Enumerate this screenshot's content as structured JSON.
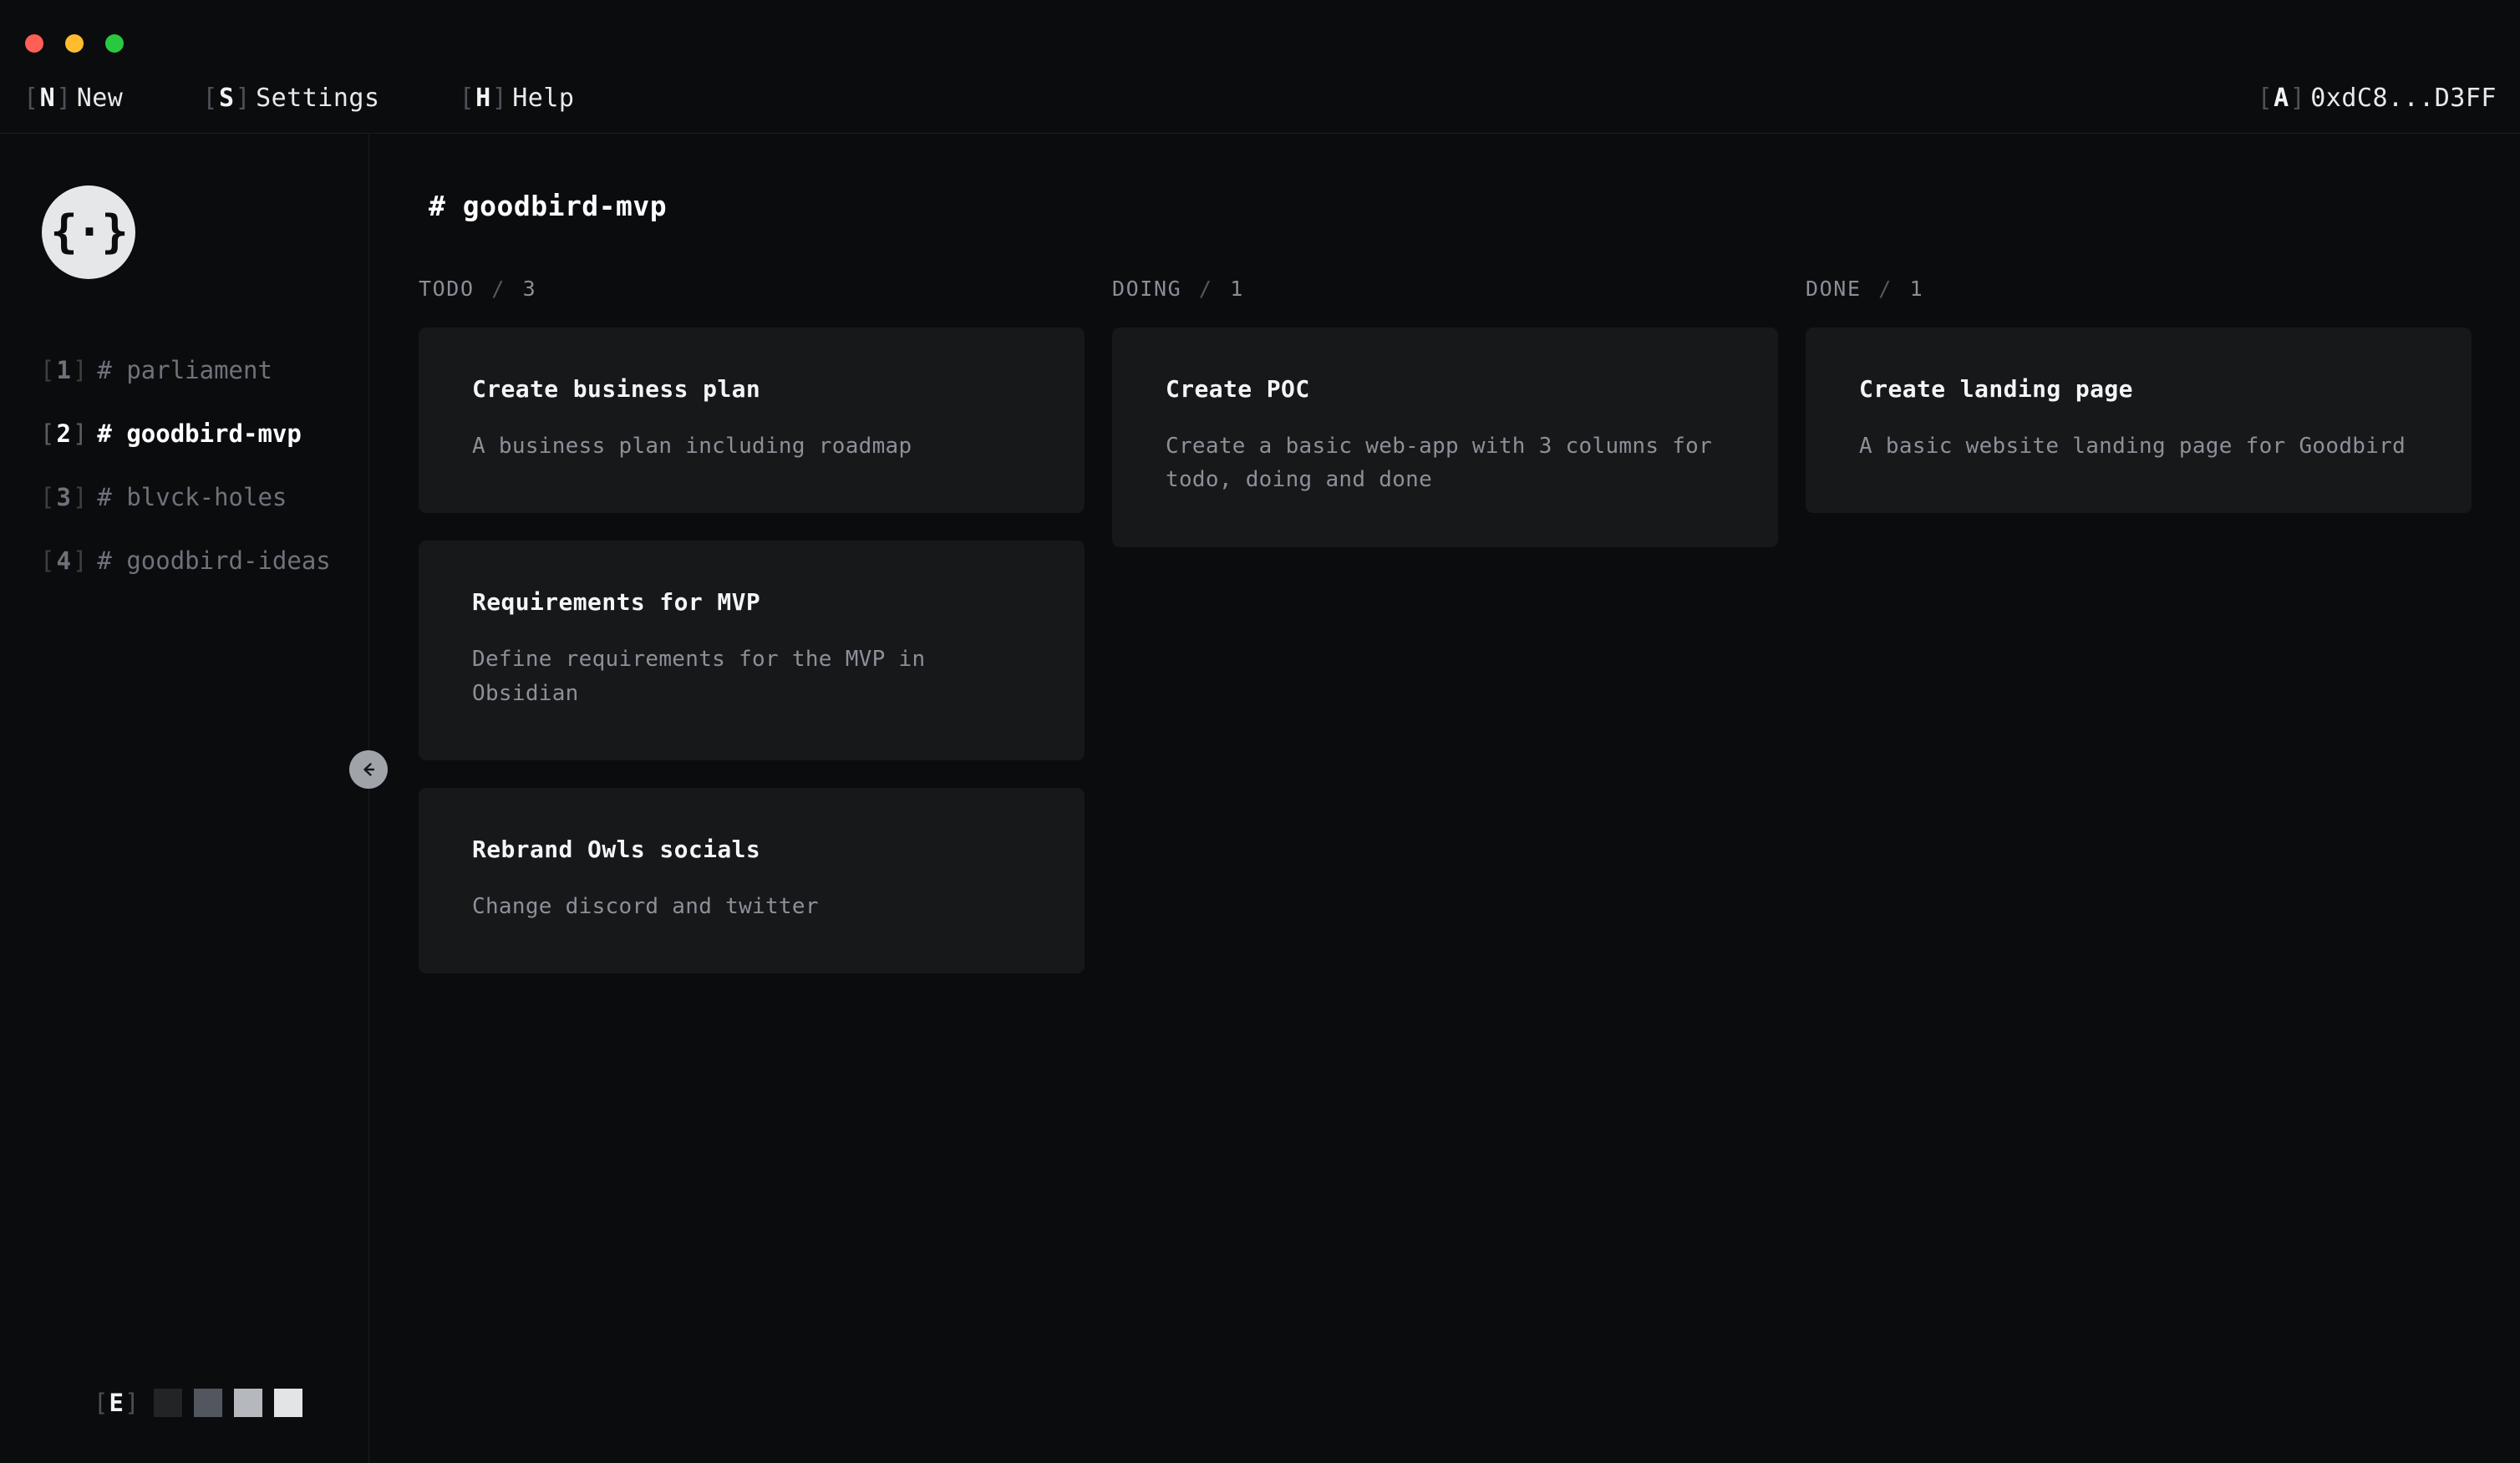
{
  "titlebar": {
    "window_controls": [
      "close",
      "minimize",
      "maximize"
    ],
    "menu": [
      {
        "key": "N",
        "label": "New",
        "open": "[",
        "close": "]"
      },
      {
        "key": "S",
        "label": "Settings",
        "open": "[",
        "close": "]"
      },
      {
        "key": "H",
        "label": "Help",
        "open": "[",
        "close": "]"
      }
    ],
    "wallet": {
      "key": "A",
      "label": "0xdC8...D3FF",
      "open": "[",
      "close": "]"
    }
  },
  "sidebar": {
    "logo": "{·}",
    "projects": [
      {
        "open": "[",
        "index": "1",
        "close": "]",
        "name": "# parliament",
        "active": false
      },
      {
        "open": "[",
        "index": "2",
        "close": "]",
        "name": "# goodbird-mvp",
        "active": true
      },
      {
        "open": "[",
        "index": "3",
        "close": "]",
        "name": "# blvck-holes",
        "active": false
      },
      {
        "open": "[",
        "index": "4",
        "close": "]",
        "name": "# goodbird-ideas",
        "active": false
      }
    ],
    "collapse_icon": "arrow-left",
    "theme": {
      "open": "[",
      "key": "E",
      "close": "]",
      "swatches": [
        "#232426",
        "#52565e",
        "#b5b9bd",
        "#e3e4e6"
      ]
    }
  },
  "board": {
    "title": "# goodbird-mvp",
    "columns": [
      {
        "name": "TODO",
        "separator": "/",
        "count": "3",
        "cards": [
          {
            "title": "Create business plan",
            "desc": "A business plan including roadmap"
          },
          {
            "title": "Requirements for MVP",
            "desc": "Define requirements for the MVP in Obsidian"
          },
          {
            "title": "Rebrand Owls socials",
            "desc": "Change discord and twitter"
          }
        ]
      },
      {
        "name": "DOING",
        "separator": "/",
        "count": "1",
        "cards": [
          {
            "title": "Create POC",
            "desc": "Create a basic web-app with 3 columns for todo, doing and done"
          }
        ]
      },
      {
        "name": "DONE",
        "separator": "/",
        "count": "1",
        "cards": [
          {
            "title": "Create landing page",
            "desc": "A basic website landing page for Goodbird"
          }
        ]
      }
    ]
  },
  "colors": {
    "background": "#0b0c0e",
    "card": "#17181a",
    "divider": "#1b1c1f",
    "text_primary": "#f4f5f6",
    "text_muted": "#8c9098",
    "accent_logo": "#e6e7e9",
    "traffic_red": "#ff5f56",
    "traffic_yellow": "#febc2e",
    "traffic_green": "#28c840"
  }
}
